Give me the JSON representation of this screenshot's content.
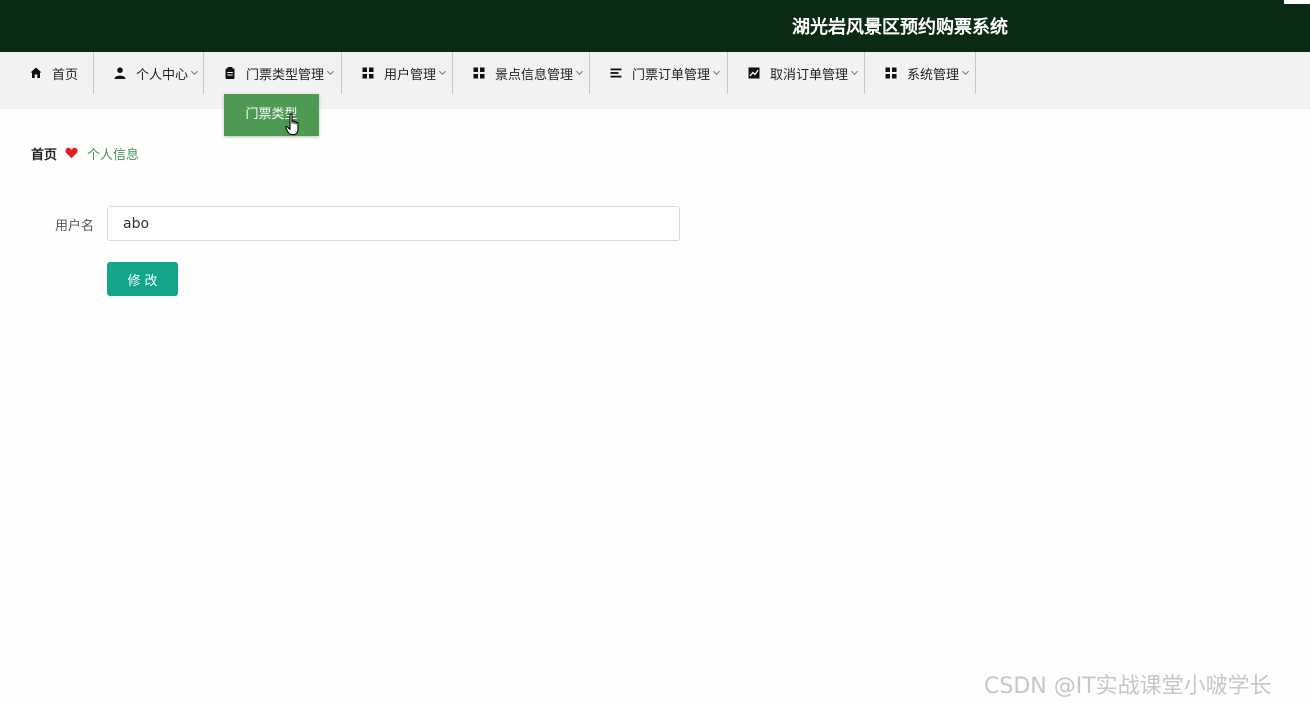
{
  "header": {
    "title": "湖光岩风景区预约购票系统"
  },
  "nav": {
    "items": [
      {
        "label": "首页",
        "icon": "home-icon",
        "has_submenu": false
      },
      {
        "label": "个人中心",
        "icon": "user-icon",
        "has_submenu": true
      },
      {
        "label": "门票类型管理",
        "icon": "clipboard-icon",
        "has_submenu": true
      },
      {
        "label": "用户管理",
        "icon": "grid-icon",
        "has_submenu": true
      },
      {
        "label": "景点信息管理",
        "icon": "grid-icon",
        "has_submenu": true
      },
      {
        "label": "门票订单管理",
        "icon": "list-icon",
        "has_submenu": true
      },
      {
        "label": "取消订单管理",
        "icon": "chart-icon",
        "has_submenu": true
      },
      {
        "label": "系统管理",
        "icon": "grid-icon",
        "has_submenu": true
      }
    ],
    "open_dropdown": {
      "parent": "门票类型管理",
      "items": [
        {
          "label": "门票类型"
        }
      ]
    }
  },
  "breadcrumb": {
    "home": "首页",
    "separator_icon": "heart-icon",
    "current": "个人信息"
  },
  "form": {
    "username_label": "用户名",
    "username_value": "abo",
    "submit_label": "修改"
  },
  "watermark": "CSDN @IT实战课堂小啵学长",
  "colors": {
    "header_bg": "#0a2a14",
    "nav_bg": "#f2f2f2",
    "dropdown_bg": "#4e9a52",
    "submit_bg": "#12a589",
    "breadcrumb_current": "#4a8f5a",
    "heart": "#e02020"
  }
}
